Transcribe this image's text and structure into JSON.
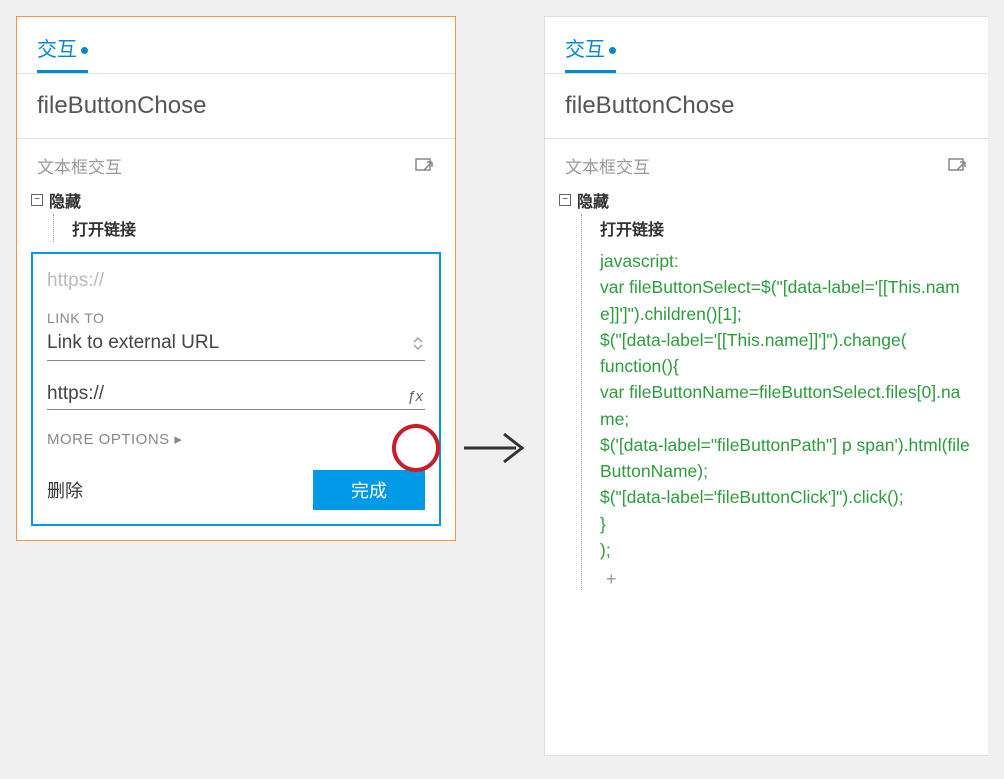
{
  "left": {
    "tab": "交互",
    "title": "fileButtonChose",
    "subsection": "文本框交互",
    "tree": {
      "root": "隐藏",
      "child": "打开链接"
    },
    "editor": {
      "placeholder": "https://",
      "linkto_label": "LINK TO",
      "linkto_value": "Link to external URL",
      "url_value": "https://",
      "fx": "ƒx",
      "more_options": "MORE OPTIONS ▸",
      "delete": "删除",
      "done": "完成"
    }
  },
  "right": {
    "tab": "交互",
    "title": "fileButtonChose",
    "subsection": "文本框交互",
    "tree": {
      "root": "隐藏",
      "child": "打开链接"
    },
    "code_lines": [
      "javascript:",
      "var fileButtonSelect=$(\"[data-label='[[This.name]]']\").children()[1];",
      "$(\"[data-label='[[This.name]]']\").change(",
      "function(){",
      "var fileButtonName=fileButtonSelect.files[0].name;",
      "",
      "$('[data-label=\"fileButtonPath\"] p span').html(fileButtonName);",
      "$(\"[data-label='fileButtonClick']\").click();",
      " }",
      ");"
    ],
    "add": "+"
  }
}
